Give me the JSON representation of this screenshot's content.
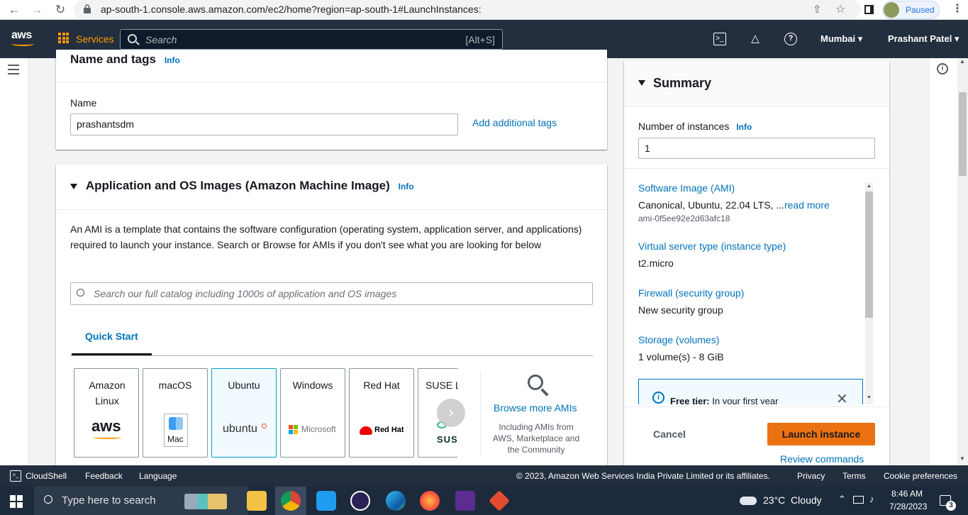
{
  "browser": {
    "url": "ap-south-1.console.aws.amazon.com/ec2/home?region=ap-south-1#LaunchInstances:",
    "profile_status": "Paused"
  },
  "awsnav": {
    "logo": "aws",
    "services_label": "Services",
    "search_placeholder": "Search",
    "search_shortcut": "[Alt+S]",
    "region": "Mumbai",
    "user": "Prashant Patel"
  },
  "name_tags": {
    "title": "Name and tags",
    "info": "Info",
    "name_label": "Name",
    "name_value": "prashantsdm",
    "add_tags_link": "Add additional tags"
  },
  "ami": {
    "title": "Application and OS Images (Amazon Machine Image)",
    "info": "Info",
    "description": "An AMI is a template that contains the software configuration (operating system, application server, and applications) required to launch your instance. Search or Browse for AMIs if you don't see what you are looking for below",
    "search_placeholder": "Search our full catalog including 1000s of application and OS images",
    "tab_quick_start": "Quick Start",
    "tiles": [
      {
        "name": "Amazon Linux",
        "logo": "aws"
      },
      {
        "name": "macOS",
        "logo": "Mac"
      },
      {
        "name": "Ubuntu",
        "logo": "ubuntu"
      },
      {
        "name": "Windows",
        "logo": "Microsoft"
      },
      {
        "name": "Red Hat",
        "logo": "Red Hat"
      },
      {
        "name": "SUSE Li",
        "logo": "SUS"
      }
    ],
    "browse_more": "Browse more AMIs",
    "browse_sub": "Including AMIs from AWS, Marketplace and the Community"
  },
  "summary": {
    "title": "Summary",
    "num_instances_label": "Number of instances",
    "info": "Info",
    "num_instances_value": "1",
    "software_image_label": "Software Image (AMI)",
    "software_image_value": "Canonical, Ubuntu, 22.04 LTS, ...",
    "read_more": "read more",
    "ami_id": "ami-0f5ee92e2d63afc18",
    "instance_type_label": "Virtual server type (instance type)",
    "instance_type_value": "t2.micro",
    "firewall_label": "Firewall (security group)",
    "firewall_value": "New security group",
    "storage_label": "Storage (volumes)",
    "storage_value": "1 volume(s) - 8 GiB",
    "free_tier_bold": "Free tier:",
    "free_tier_text": " In your first year",
    "cancel": "Cancel",
    "launch": "Launch instance",
    "review": "Review commands"
  },
  "footer": {
    "cloudshell": "CloudShell",
    "feedback": "Feedback",
    "language": "Language",
    "copyright": "© 2023, Amazon Web Services India Private Limited or its affiliates.",
    "privacy": "Privacy",
    "terms": "Terms",
    "cookies": "Cookie preferences"
  },
  "taskbar": {
    "search_placeholder": "Type here to search",
    "weather": "23°C  Cloudy",
    "time": "8:46 AM",
    "date": "7/28/2023",
    "notifications": "3"
  },
  "colors": {
    "aws_nav": "#232f3e",
    "aws_orange": "#ff9900",
    "link_blue": "#0073bb",
    "launch_button": "#ec7211"
  }
}
